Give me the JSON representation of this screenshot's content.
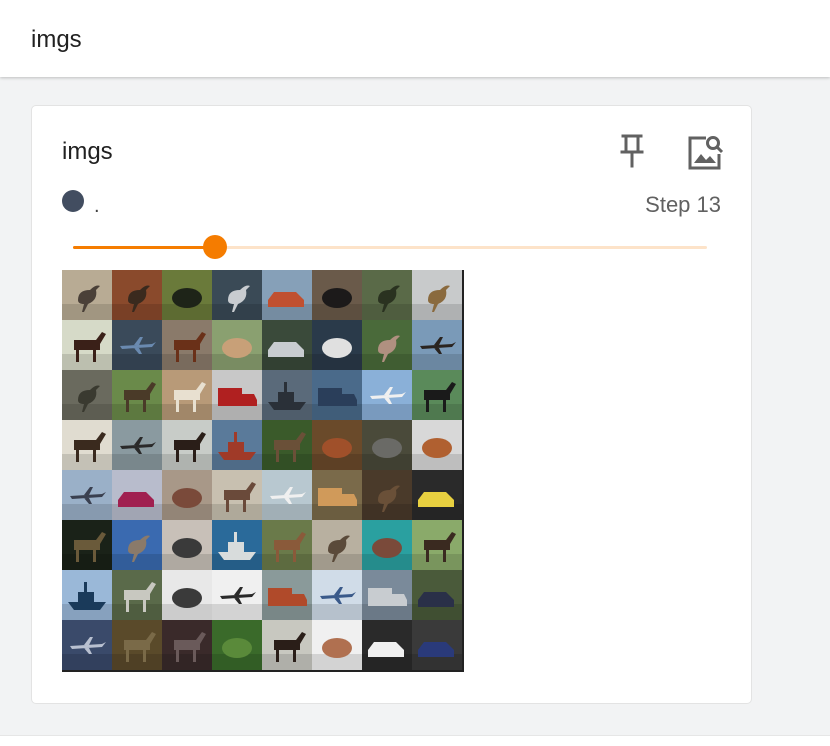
{
  "header": {
    "title": "imgs"
  },
  "card": {
    "title": "imgs",
    "run_name": ".",
    "step_label": "Step 13",
    "run_color": "#424d60",
    "slider": {
      "value_fraction": 0.224,
      "accent": "#f57c00",
      "track": "#fde3c9"
    },
    "icons": {
      "pin": "pin-icon",
      "image_search": "image-search-icon"
    },
    "grid": {
      "columns": 8,
      "rows": 8,
      "tiles": [
        [
          "#b8ab94",
          "#4a4038",
          "bird"
        ],
        [
          "#8a4a2c",
          "#3a2a1e",
          "ostrich"
        ],
        [
          "#6a7a3a",
          "#1e2418",
          "dog"
        ],
        [
          "#3a4a56",
          "#c8ccd0",
          "bird"
        ],
        [
          "#86a0b8",
          "#c05030",
          "car"
        ],
        [
          "#6a5a4a",
          "#1c1a1a",
          "animal"
        ],
        [
          "#5a6a48",
          "#2a3220",
          "bird"
        ],
        [
          "#c8cacb",
          "#8a6a3e",
          "bird"
        ],
        [
          "#d6dac8",
          "#3a2018",
          "horse"
        ],
        [
          "#3a4a5a",
          "#6a8ab0",
          "plane"
        ],
        [
          "#8a7a6a",
          "#6a3018",
          "horse"
        ],
        [
          "#8aa070",
          "#c8a078",
          "animal"
        ],
        [
          "#3a4a3a",
          "#c8ccd0",
          "car"
        ],
        [
          "#2a3a4a",
          "#e0e0e0",
          "cat"
        ],
        [
          "#4a6a3a",
          "#b09080",
          "bird"
        ],
        [
          "#7a9ab8",
          "#2a2420",
          "plane"
        ],
        [
          "#6a6a5e",
          "#3a3a30",
          "bird"
        ],
        [
          "#6a8a4a",
          "#4a3a28",
          "deer"
        ],
        [
          "#b89a78",
          "#e8e0d0",
          "horse"
        ],
        [
          "#c8c8c8",
          "#b02020",
          "truck"
        ],
        [
          "#5a6a7a",
          "#2a3038",
          "ship"
        ],
        [
          "#4a6a8a",
          "#2a3e5a",
          "truck"
        ],
        [
          "#8ab0d8",
          "#f0f0f0",
          "plane"
        ],
        [
          "#5a8a5a",
          "#1a1a1a",
          "horse"
        ],
        [
          "#e0dcd0",
          "#3a2a1e",
          "horse"
        ],
        [
          "#8a9aa0",
          "#2a2a2a",
          "plane"
        ],
        [
          "#c8ccc8",
          "#2a1e18",
          "horse"
        ],
        [
          "#5a7a9a",
          "#a03a28",
          "ship"
        ],
        [
          "#3a5a2a",
          "#6a5038",
          "deer"
        ],
        [
          "#6a4a2a",
          "#a0502a",
          "frog"
        ],
        [
          "#4a4a3a",
          "#6a6a66",
          "cat"
        ],
        [
          "#d8d8d8",
          "#b06030",
          "cat"
        ],
        [
          "#9ab0c8",
          "#3a4050",
          "plane"
        ],
        [
          "#b8bccc",
          "#a02050",
          "car"
        ],
        [
          "#a89888",
          "#7a4a3a",
          "frog"
        ],
        [
          "#c8c0b0",
          "#6a4a3a",
          "horse"
        ],
        [
          "#b8c8d0",
          "#f0f0f0",
          "plane"
        ],
        [
          "#7a6a4a",
          "#d09a5a",
          "truck"
        ],
        [
          "#4a3a2a",
          "#6a5038",
          "bird"
        ],
        [
          "#2a2a2a",
          "#e8d040",
          "car"
        ],
        [
          "#1a2218",
          "#6a5a3a",
          "deer"
        ],
        [
          "#3a6ab0",
          "#8a7a6a",
          "ostrich"
        ],
        [
          "#c8c0b8",
          "#3a3a3a",
          "cat"
        ],
        [
          "#2a6a9a",
          "#d8dcdc",
          "ship"
        ],
        [
          "#6a7a4a",
          "#8a5a3a",
          "deer"
        ],
        [
          "#b8b0a0",
          "#5a4a3a",
          "bird"
        ],
        [
          "#2aa0a0",
          "#7a4a3a",
          "frog"
        ],
        [
          "#8aaa6a",
          "#3a2a20",
          "horse"
        ],
        [
          "#9ab8d8",
          "#1a3a5a",
          "ship"
        ],
        [
          "#5a6a4a",
          "#c8c8c0",
          "deer"
        ],
        [
          "#e8e8e8",
          "#3a3a3a",
          "animal"
        ],
        [
          "#f0f0f0",
          "#2a2a2a",
          "plane"
        ],
        [
          "#8a9a9a",
          "#b04a2a",
          "truck"
        ],
        [
          "#d0dce8",
          "#3a5a8a",
          "plane"
        ],
        [
          "#7a8a9a",
          "#c8ccd0",
          "truck"
        ],
        [
          "#4a5a3a",
          "#2a3048",
          "car"
        ],
        [
          "#3a4a6a",
          "#b8c0d0",
          "plane"
        ],
        [
          "#5a4a2a",
          "#7a6a48",
          "deer"
        ],
        [
          "#3a2a2a",
          "#6a5a5a",
          "deer"
        ],
        [
          "#3a6a2a",
          "#5a8a3a",
          "frog"
        ],
        [
          "#c8c8c0",
          "#2a1e18",
          "horse"
        ],
        [
          "#f0f0f0",
          "#b07050",
          "frog"
        ],
        [
          "#2a2a2a",
          "#f0f0f0",
          "car"
        ],
        [
          "#3a3a3a",
          "#2a3a7a",
          "car"
        ]
      ]
    }
  }
}
